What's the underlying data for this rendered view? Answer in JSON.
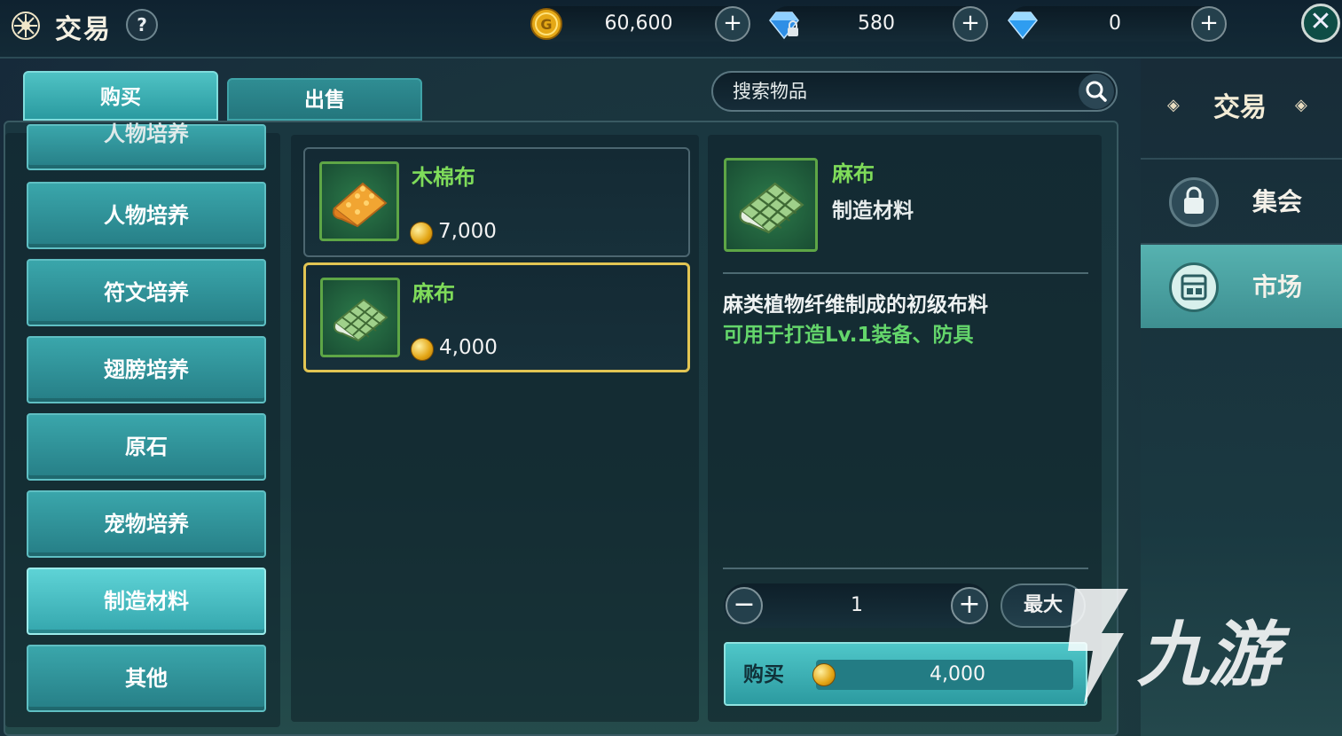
{
  "header": {
    "title": "交易",
    "help_label": "?",
    "currencies": [
      {
        "icon": "gold-coin-icon",
        "value": "60,600",
        "plus": "+"
      },
      {
        "icon": "locked-diamond-icon",
        "value": "580",
        "plus": "+"
      },
      {
        "icon": "diamond-icon",
        "value": "0",
        "plus": "+"
      }
    ],
    "close_label": "✕"
  },
  "tabs": {
    "buy": "购买",
    "sell": "出售"
  },
  "search": {
    "placeholder": "搜索物品"
  },
  "categories": [
    {
      "label": "人物培养",
      "partial": true
    },
    {
      "label": "人物培养"
    },
    {
      "label": "符文培养"
    },
    {
      "label": "翅膀培养"
    },
    {
      "label": "原石"
    },
    {
      "label": "宠物培养"
    },
    {
      "label": "制造材料",
      "active": true
    },
    {
      "label": "其他"
    }
  ],
  "items": [
    {
      "name": "木棉布",
      "price": "7,000",
      "icon": "cotton-cloth-icon"
    },
    {
      "name": "麻布",
      "price": "4,000",
      "icon": "linen-cloth-icon",
      "selected": true
    }
  ],
  "detail": {
    "name": "麻布",
    "category": "制造材料",
    "description": "麻类植物纤维制成的初级布料",
    "usage": "可用于打造Lv.1装备、防具",
    "quantity": "1",
    "minus": "−",
    "plus": "+",
    "max_label": "最大",
    "buy_label": "购买",
    "buy_price": "4,000"
  },
  "side": {
    "title": "交易",
    "items": [
      {
        "label": "集会",
        "icon": "bag-lock-icon"
      },
      {
        "label": "市场",
        "icon": "market-icon",
        "active": true
      }
    ]
  },
  "watermark": "九游",
  "colors": {
    "accent": "#3aa6ab",
    "gold": "#e3a514",
    "item_green": "#7fdc5a",
    "usage_green": "#64d66b",
    "selected_border": "#e2c553"
  }
}
